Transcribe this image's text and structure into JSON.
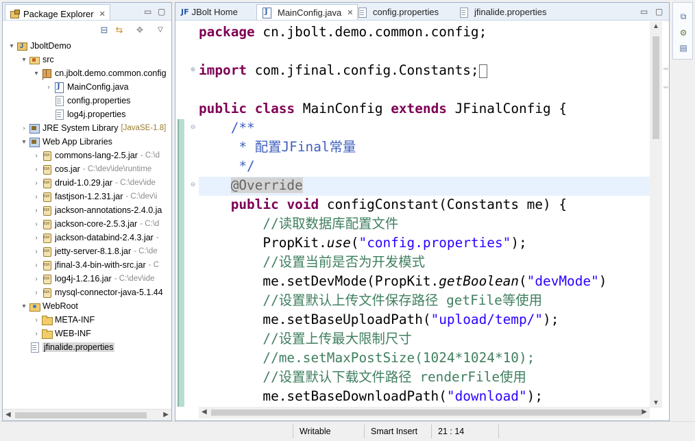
{
  "explorer": {
    "title": "Package Explorer",
    "close_glyph": "✕",
    "minimize_glyph": "▭",
    "maximize_glyph": "▢",
    "toolbar": [
      "collapse-all",
      "link-with-editor",
      "focus-on-working-set",
      "view-menu"
    ],
    "tree": [
      {
        "label": "JboltDemo",
        "icon": "project",
        "indent": 0,
        "twisty": "▾"
      },
      {
        "label": "src",
        "icon": "src",
        "indent": 1,
        "twisty": "▾"
      },
      {
        "label": "cn.jbolt.demo.common.config",
        "icon": "package",
        "indent": 2,
        "twisty": "▾"
      },
      {
        "label": "MainConfig.java",
        "icon": "java",
        "indent": 3,
        "twisty": "›"
      },
      {
        "label": "config.properties",
        "icon": "file",
        "indent": 3,
        "twisty": ""
      },
      {
        "label": "log4j.properties",
        "icon": "file",
        "indent": 3,
        "twisty": ""
      },
      {
        "label": "JRE System Library",
        "icon": "library",
        "indent": 1,
        "twisty": "›",
        "decoration": "[JavaSE-1.8]"
      },
      {
        "label": "Web App Libraries",
        "icon": "library",
        "indent": 1,
        "twisty": "▾"
      },
      {
        "label": "commons-lang-2.5.jar",
        "icon": "jar",
        "indent": 2,
        "twisty": "›",
        "path": "- C:\\d"
      },
      {
        "label": "cos.jar",
        "icon": "jar",
        "indent": 2,
        "twisty": "›",
        "path": "- C:\\dev\\ide\\runtime"
      },
      {
        "label": "druid-1.0.29.jar",
        "icon": "jar",
        "indent": 2,
        "twisty": "›",
        "path": "- C:\\dev\\ide"
      },
      {
        "label": "fastjson-1.2.31.jar",
        "icon": "jar",
        "indent": 2,
        "twisty": "›",
        "path": "- C:\\dev\\i"
      },
      {
        "label": "jackson-annotations-2.4.0.ja",
        "icon": "jar",
        "indent": 2,
        "twisty": "›",
        "path": ""
      },
      {
        "label": "jackson-core-2.5.3.jar",
        "icon": "jar",
        "indent": 2,
        "twisty": "›",
        "path": "- C:\\d"
      },
      {
        "label": "jackson-databind-2.4.3.jar",
        "icon": "jar",
        "indent": 2,
        "twisty": "›",
        "path": "-"
      },
      {
        "label": "jetty-server-8.1.8.jar",
        "icon": "jar",
        "indent": 2,
        "twisty": "›",
        "path": "- C:\\de"
      },
      {
        "label": "jfinal-3.4-bin-with-src.jar",
        "icon": "jar",
        "indent": 2,
        "twisty": "›",
        "path": "- C"
      },
      {
        "label": "log4j-1.2.16.jar",
        "icon": "jar",
        "indent": 2,
        "twisty": "›",
        "path": "- C:\\dev\\ide"
      },
      {
        "label": "mysql-connector-java-5.1.44",
        "icon": "jar",
        "indent": 2,
        "twisty": "›",
        "path": ""
      },
      {
        "label": "WebRoot",
        "icon": "webroot",
        "indent": 1,
        "twisty": "▾"
      },
      {
        "label": "META-INF",
        "icon": "folder",
        "indent": 2,
        "twisty": "›"
      },
      {
        "label": "WEB-INF",
        "icon": "folder",
        "indent": 2,
        "twisty": "›"
      },
      {
        "label": "jfinalide.properties",
        "icon": "file",
        "indent": 1,
        "twisty": "",
        "selected": true
      }
    ]
  },
  "editor": {
    "tabs": [
      {
        "label": "JBolt Home",
        "icon": "JF",
        "active": false,
        "closable": false
      },
      {
        "label": "MainConfig.java",
        "icon": "java",
        "active": true,
        "closable": true
      },
      {
        "label": "config.properties",
        "icon": "file",
        "active": false,
        "closable": false
      },
      {
        "label": "jfinalide.properties",
        "icon": "file",
        "active": false,
        "closable": false
      }
    ],
    "close_glyph": "✕",
    "minimize_glyph": "▭",
    "maximize_glyph": "▢",
    "code_lines": [
      [
        {
          "t": "package",
          "c": "kw"
        },
        {
          "t": " cn.jbolt.demo.common.config;",
          "c": ""
        }
      ],
      [],
      [
        {
          "t": "import",
          "c": "kw"
        },
        {
          "t": " com.jfinal.config.Constants;",
          "c": ""
        },
        {
          "t": "",
          "c": "caret"
        }
      ],
      [],
      [
        {
          "t": "public",
          "c": "kw"
        },
        {
          "t": " ",
          "c": ""
        },
        {
          "t": "class",
          "c": "kw"
        },
        {
          "t": " MainConfig ",
          "c": ""
        },
        {
          "t": "extends",
          "c": "kw"
        },
        {
          "t": " JFinalConfig {",
          "c": ""
        }
      ],
      [
        {
          "t": "    /**",
          "c": "jd"
        }
      ],
      [
        {
          "t": "     * 配置JFinal常量",
          "c": "jd"
        }
      ],
      [
        {
          "t": "     */",
          "c": "jd"
        }
      ],
      [
        {
          "t": "    ",
          "c": ""
        },
        {
          "t": "@Override",
          "c": "an"
        }
      ],
      [
        {
          "t": "    ",
          "c": ""
        },
        {
          "t": "public",
          "c": "kw"
        },
        {
          "t": " ",
          "c": ""
        },
        {
          "t": "void",
          "c": "kw"
        },
        {
          "t": " configConstant(Constants me) {",
          "c": ""
        }
      ],
      [
        {
          "t": "        //读取数据库配置文件",
          "c": "lc"
        }
      ],
      [
        {
          "t": "        PropKit.",
          "c": ""
        },
        {
          "t": "use",
          "c": "it"
        },
        {
          "t": "(",
          "c": ""
        },
        {
          "t": "\"config.properties\"",
          "c": "st"
        },
        {
          "t": ");",
          "c": ""
        }
      ],
      [
        {
          "t": "        //设置当前是否为开发模式",
          "c": "lc"
        }
      ],
      [
        {
          "t": "        me.setDevMode(PropKit.",
          "c": ""
        },
        {
          "t": "getBoolean",
          "c": "it"
        },
        {
          "t": "(",
          "c": ""
        },
        {
          "t": "\"devMode\"",
          "c": "st"
        },
        {
          "t": ")",
          "c": ""
        }
      ],
      [
        {
          "t": "        //设置默认上传文件保存路径 getFile等使用",
          "c": "lc"
        }
      ],
      [
        {
          "t": "        me.setBaseUploadPath(",
          "c": ""
        },
        {
          "t": "\"upload/temp/\"",
          "c": "st"
        },
        {
          "t": ");",
          "c": ""
        }
      ],
      [
        {
          "t": "        //设置上传最大限制尺寸",
          "c": "lc"
        }
      ],
      [
        {
          "t": "        //me.setMaxPostSize(1024*1024*10);",
          "c": "lc"
        }
      ],
      [
        {
          "t": "        //设置默认下载文件路径 renderFile使用",
          "c": "lc"
        }
      ],
      [
        {
          "t": "        me.setBaseDownloadPath(",
          "c": ""
        },
        {
          "t": "\"download\"",
          "c": "st"
        },
        {
          "t": ");",
          "c": ""
        }
      ]
    ],
    "fold_markers": [
      {
        "line": 2,
        "glyph": "⊕"
      },
      {
        "line": 5,
        "glyph": "⊖"
      },
      {
        "line": 8,
        "glyph": "⊖"
      }
    ],
    "highlighted_line": 8
  },
  "status": {
    "writable": "Writable",
    "insert_mode": "Smart Insert",
    "position": "21 : 14"
  },
  "right_trim": {
    "buttons": [
      "restore-icon",
      "outline-icon",
      "task-list-icon"
    ]
  },
  "colors": {
    "keyword": "#7f0055",
    "javadoc": "#3f5fbf",
    "line_comment": "#3f7f5f",
    "string": "#2a00ff",
    "annotation": "#646464",
    "highlight_line": "#e8f2fe"
  }
}
